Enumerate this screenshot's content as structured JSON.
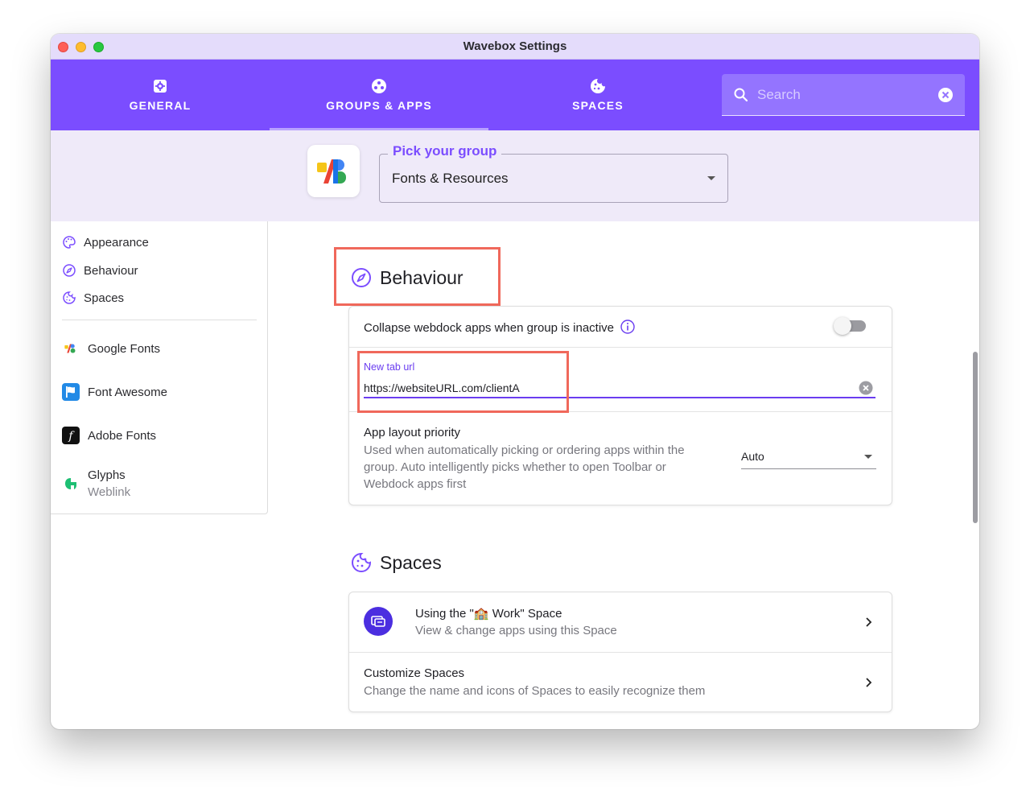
{
  "window": {
    "title": "Wavebox Settings"
  },
  "nav": {
    "tabs": [
      {
        "label": "GENERAL",
        "icon": "settings-icon"
      },
      {
        "label": "GROUPS & APPS",
        "icon": "groups-icon"
      },
      {
        "label": "SPACES",
        "icon": "spaces-icon"
      }
    ],
    "active_tab": "GROUPS & APPS",
    "search": {
      "placeholder": "Search",
      "value": ""
    }
  },
  "group_picker": {
    "label": "Pick your group",
    "value": "Fonts & Resources"
  },
  "sidebar": {
    "sections": [
      {
        "label": "Appearance",
        "icon": "palette-icon"
      },
      {
        "label": "Behaviour",
        "icon": "compass-icon"
      },
      {
        "label": "Spaces",
        "icon": "cookie-icon"
      }
    ],
    "apps": [
      {
        "label": "Google Fonts",
        "icon": "google-fonts-icon"
      },
      {
        "label": "Font Awesome",
        "icon": "font-awesome-icon"
      },
      {
        "label": "Adobe Fonts",
        "icon": "adobe-fonts-icon"
      },
      {
        "label": "Glyphs",
        "sublabel": "Weblink",
        "icon": "glyphs-icon"
      }
    ]
  },
  "behaviour": {
    "title": "Behaviour",
    "collapse_label": "Collapse webdock apps when group is inactive",
    "collapse_enabled": false,
    "new_tab_label": "New tab url",
    "new_tab_value": "https://websiteURL.com/clientA",
    "layout_title": "App layout priority",
    "layout_desc": "Used when automatically picking or ordering apps within the group. Auto intelligently picks whether to open Toolbar or Webdock apps first",
    "layout_value": "Auto"
  },
  "spaces": {
    "title": "Spaces",
    "using_title": "Using the \"🏫 Work\" Space",
    "using_desc": "View & change apps using this Space",
    "customize_title": "Customize Spaces",
    "customize_desc": "Change the name and icons of Spaces to easily recognize them"
  },
  "colors": {
    "accent": "#7b4dff",
    "header_bg": "#7b4dff",
    "group_bar_bg": "#efeaf9",
    "highlight": "#f0685b"
  }
}
